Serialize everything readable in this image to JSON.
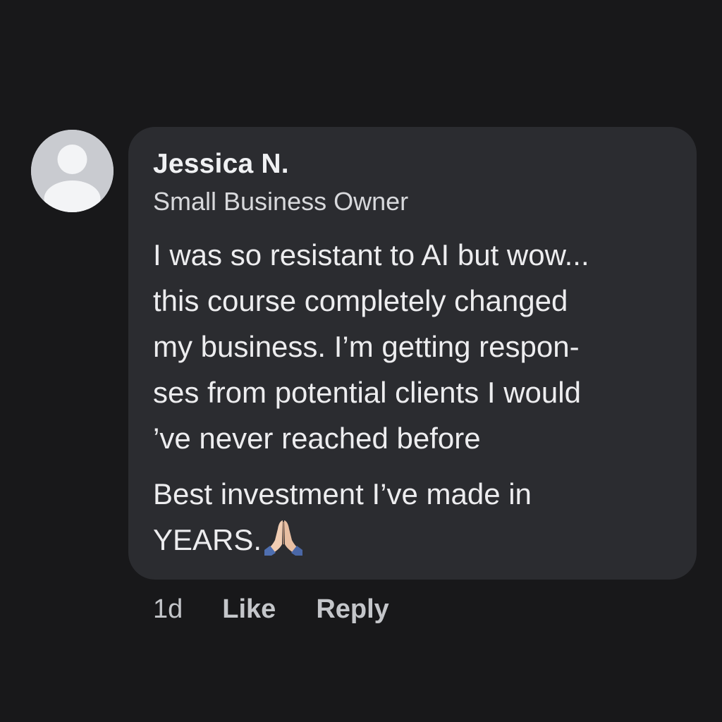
{
  "comment": {
    "author": "Jessica N.",
    "subtitle": "Small Business Owner",
    "body_lines": [
      "I was so resistant to AI but wow...",
      "this course completely changed",
      "my business. I’m getting respon-",
      "ses from potential clients I would",
      "’ve never reached before"
    ],
    "closing_lines": [
      "Best investment I’ve made in",
      "YEARS."
    ],
    "emoji": "folded-hands-icon",
    "timestamp": "1d",
    "like_label": "Like",
    "reply_label": "Reply"
  },
  "colors": {
    "background": "#18181a",
    "bubble": "#2b2c30",
    "avatar": "#c9cbd0",
    "text": "#ededef",
    "muted": "#c4c6ca"
  }
}
